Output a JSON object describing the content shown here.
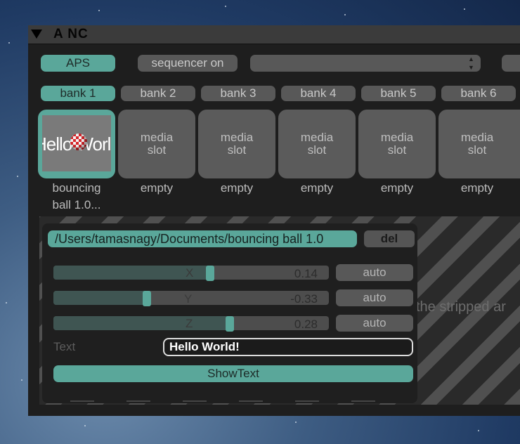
{
  "window": {
    "title": "A  NC"
  },
  "toolbar": {
    "aps_label": "APS",
    "sequencer_label": "sequencer on",
    "select_arrows": "▲▼"
  },
  "banks": [
    "bank 1",
    "bank 2",
    "bank 3",
    "bank 4",
    "bank 5",
    "bank 6"
  ],
  "slots": [
    {
      "thumb_text": "Hello World",
      "caption_1": "bouncing",
      "caption_2": "ball 1.0..."
    },
    {
      "label_1": "media",
      "label_2": "slot",
      "caption": "empty"
    },
    {
      "label_1": "media",
      "label_2": "slot",
      "caption": "empty"
    },
    {
      "label_1": "media",
      "label_2": "slot",
      "caption": "empty"
    },
    {
      "label_1": "media",
      "label_2": "slot",
      "caption": "empty"
    },
    {
      "label_1": "media",
      "label_2": "slot",
      "caption": "empty"
    }
  ],
  "detail": {
    "file_path": "/Users/tamasnagy/Documents/bouncing ball 1.0",
    "del_label": "del",
    "ghost_text": "the stripped ar",
    "sliders": [
      {
        "axis": "X",
        "value": "0.14",
        "level": 0.57,
        "auto": "auto"
      },
      {
        "axis": "Y",
        "value": "-0.33",
        "level": 0.34,
        "auto": "auto"
      },
      {
        "axis": "Z",
        "value": "0.28",
        "level": 0.64,
        "auto": "auto"
      }
    ],
    "text_label": "Text",
    "text_value": "Hello World!",
    "show_text_label": "ShowText"
  },
  "colors": {
    "accent": "#5aa79a",
    "panel": "#1e1e1e",
    "control": "#585858"
  }
}
